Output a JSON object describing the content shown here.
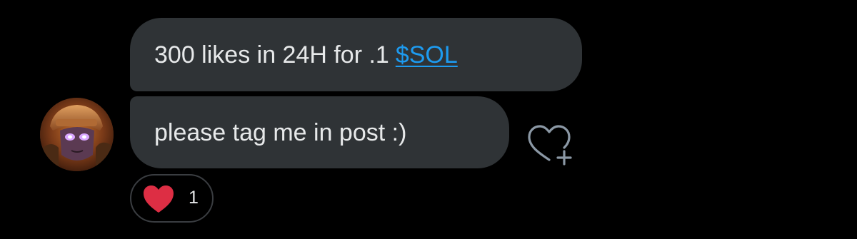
{
  "messages": [
    {
      "text": "300 likes in 24H for .1",
      "link_text": "$SOL"
    },
    {
      "text": "please tag me in post :)"
    }
  ],
  "reactions": {
    "emoji_icon": "red-heart-icon",
    "count": "1"
  },
  "react_button_icon": "heart-plus-icon",
  "avatar_icon": "user-avatar",
  "colors": {
    "background": "#000000",
    "bubble": "#2f3336",
    "text": "#e7e9ea",
    "link": "#1d9bf0",
    "heart": "#e0245e"
  }
}
